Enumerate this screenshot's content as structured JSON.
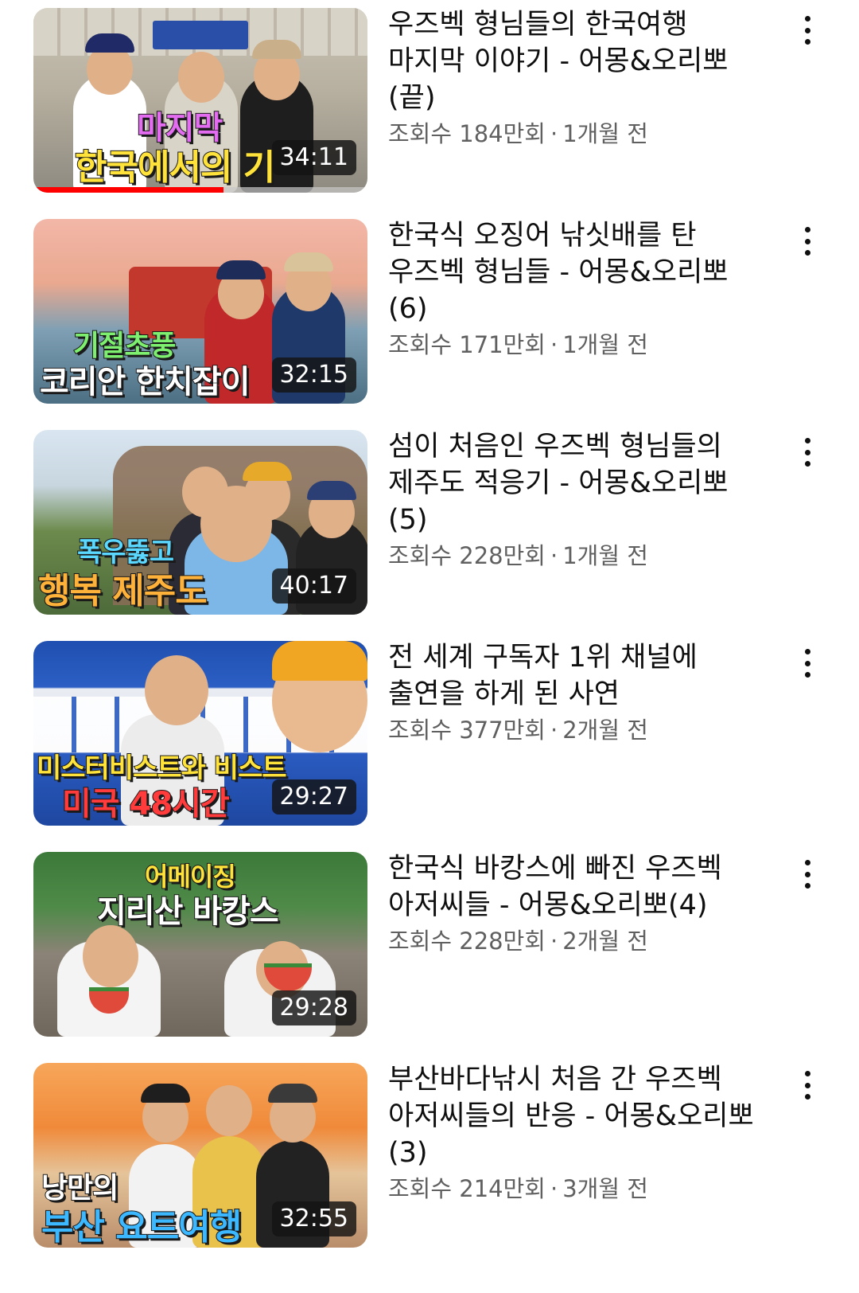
{
  "videos": [
    {
      "title": "우즈벡 형님들의 한국여행 마지막 이야기 - 어몽&오리뽀(끝)",
      "views": "조회수 184만회",
      "age": "1개월 전",
      "duration": "34:11",
      "watched_fraction": 0.57,
      "caption_lines": [
        "마지막",
        "한국에서의 기"
      ],
      "caption_colors": [
        "#e36cf0",
        "#ffe23a"
      ]
    },
    {
      "title": "한국식 오징어 낚싯배를 탄 우즈벡 형님들 - 어몽&오리뽀(6)",
      "views": "조회수 171만회",
      "age": "1개월 전",
      "duration": "32:15",
      "caption_lines": [
        "기절초풍",
        "코리안 한치잡이"
      ],
      "caption_colors": [
        "#7ef070",
        "#ffffff"
      ]
    },
    {
      "title": "섬이 처음인 우즈벡 형님들의 제주도 적응기 - 어몽&오리뽀(5)",
      "views": "조회수 228만회",
      "age": "1개월 전",
      "duration": "40:17",
      "caption_lines": [
        "폭우뚫고",
        "행복 제주도"
      ],
      "caption_colors": [
        "#5ad8ff",
        "#ffb23a"
      ]
    },
    {
      "title": "전 세계 구독자 1위 채널에 출연을 하게 된 사연",
      "views": "조회수 377만회",
      "age": "2개월 전",
      "duration": "29:27",
      "caption_lines": [
        "미스터비스트와 비스트",
        "미국 48시간"
      ],
      "caption_colors": [
        "#ffe23a",
        "#ff3b3b"
      ]
    },
    {
      "title": "한국식 바캉스에 빠진 우즈벡 아저씨들 - 어몽&오리뽀(4)",
      "views": "조회수 228만회",
      "age": "2개월 전",
      "duration": "29:28",
      "caption_lines": [
        "어메이징",
        "지리산 바캉스"
      ],
      "caption_colors": [
        "#ffe23a",
        "#ffffff"
      ]
    },
    {
      "title": "부산바다낚시 처음 간 우즈벡 아저씨들의 반응 - 어몽&오리뽀(3)",
      "views": "조회수 214만회",
      "age": "3개월 전",
      "duration": "32:55",
      "caption_lines": [
        "낭만의",
        "부산 요트여행"
      ],
      "caption_colors": [
        "#ffffff",
        "#3bb8ff"
      ]
    }
  ],
  "meta_separator": "·",
  "icons": {
    "more": "more-vertical-icon"
  }
}
